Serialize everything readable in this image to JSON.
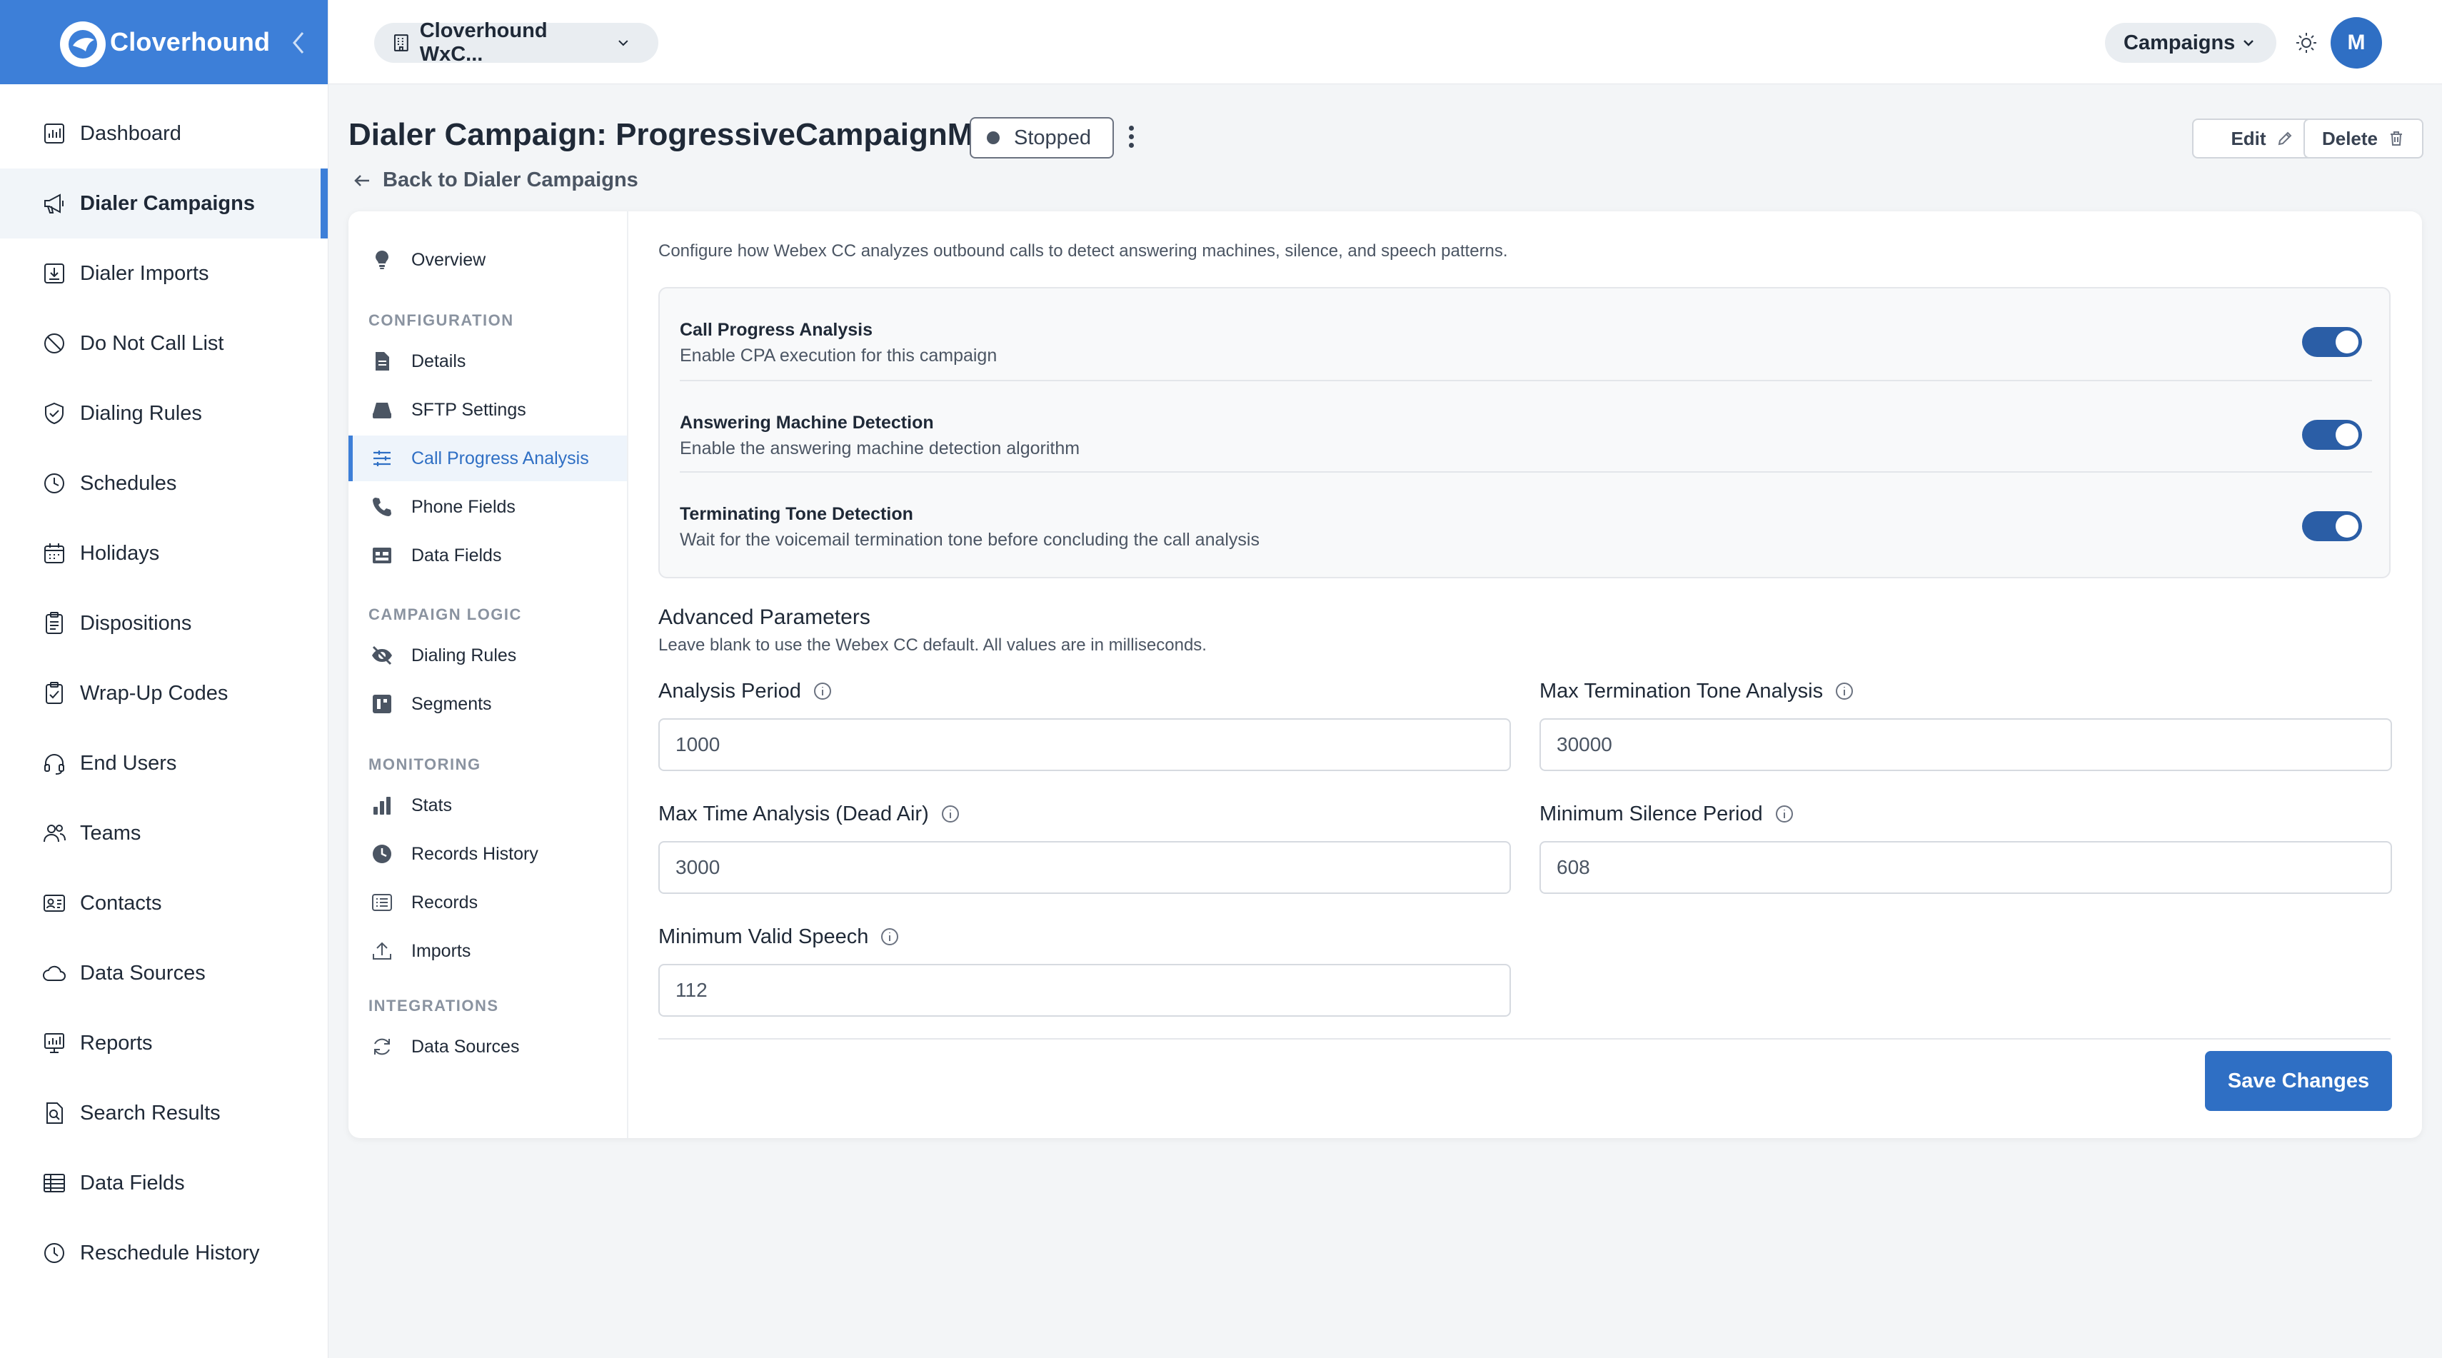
{
  "brand": {
    "name": "Cloverhound"
  },
  "sidebar": {
    "items": [
      {
        "label": "Dashboard",
        "icon": "dashboard-icon",
        "active": false
      },
      {
        "label": "Dialer Campaigns",
        "icon": "megaphone-icon",
        "active": true
      },
      {
        "label": "Dialer Imports",
        "icon": "import-icon",
        "active": false
      },
      {
        "label": "Do Not Call List",
        "icon": "ban-icon",
        "active": false
      },
      {
        "label": "Dialing Rules",
        "icon": "shield-check-icon",
        "active": false
      },
      {
        "label": "Schedules",
        "icon": "clock-icon",
        "active": false
      },
      {
        "label": "Holidays",
        "icon": "calendar-icon",
        "active": false
      },
      {
        "label": "Dispositions",
        "icon": "clipboard-icon",
        "active": false
      },
      {
        "label": "Wrap-Up Codes",
        "icon": "clipboard-check-icon",
        "active": false
      },
      {
        "label": "End Users",
        "icon": "headset-icon",
        "active": false
      },
      {
        "label": "Teams",
        "icon": "users-icon",
        "active": false
      },
      {
        "label": "Contacts",
        "icon": "contact-card-icon",
        "active": false
      },
      {
        "label": "Data Sources",
        "icon": "cloud-icon",
        "active": false
      },
      {
        "label": "Reports",
        "icon": "report-icon",
        "active": false
      },
      {
        "label": "Search Results",
        "icon": "file-search-icon",
        "active": false
      },
      {
        "label": "Data Fields",
        "icon": "table-icon",
        "active": false
      },
      {
        "label": "Reschedule History",
        "icon": "history-icon",
        "active": false
      }
    ]
  },
  "topbar": {
    "org": "Cloverhound WxC...",
    "module": "Campaigns",
    "avatar": "M"
  },
  "header": {
    "title": "Dialer Campaign: ProgressiveCampaignM",
    "status": "Stopped",
    "back": "Back to Dialer Campaigns",
    "edit": "Edit",
    "delete": "Delete"
  },
  "subnav": {
    "overview": "Overview",
    "sections": [
      {
        "title": "CONFIGURATION",
        "items": [
          "Details",
          "SFTP Settings",
          "Call Progress Analysis",
          "Phone Fields",
          "Data Fields"
        ]
      },
      {
        "title": "CAMPAIGN LOGIC",
        "items": [
          "Dialing Rules",
          "Segments"
        ]
      },
      {
        "title": "MONITORING",
        "items": [
          "Stats",
          "Records History",
          "Records",
          "Imports"
        ]
      },
      {
        "title": "INTEGRATIONS",
        "items": [
          "Data Sources"
        ]
      }
    ],
    "active": "Call Progress Analysis"
  },
  "cpa": {
    "intro": "Configure how Webex CC analyzes outbound calls to detect answering machines, silence, and speech patterns.",
    "toggles": [
      {
        "title": "Call Progress Analysis",
        "desc": "Enable CPA execution for this campaign",
        "on": true
      },
      {
        "title": "Answering Machine Detection",
        "desc": "Enable the answering machine detection algorithm",
        "on": true
      },
      {
        "title": "Terminating Tone Detection",
        "desc": "Wait for the voicemail termination tone before concluding the call analysis",
        "on": true
      }
    ],
    "advanced_title": "Advanced Parameters",
    "advanced_desc": "Leave blank to use the Webex CC default. All values are in milliseconds.",
    "fields": [
      {
        "label": "Analysis Period",
        "value": "1000"
      },
      {
        "label": "Max Termination Tone Analysis",
        "value": "30000"
      },
      {
        "label": "Max Time Analysis (Dead Air)",
        "value": "3000"
      },
      {
        "label": "Minimum Silence Period",
        "value": "608"
      },
      {
        "label": "Minimum Valid Speech",
        "value": "112"
      }
    ],
    "save": "Save Changes"
  },
  "colors": {
    "brand": "#3d7fd8",
    "primary": "#2f6fc4",
    "toggle_on": "#2b5ea6"
  }
}
